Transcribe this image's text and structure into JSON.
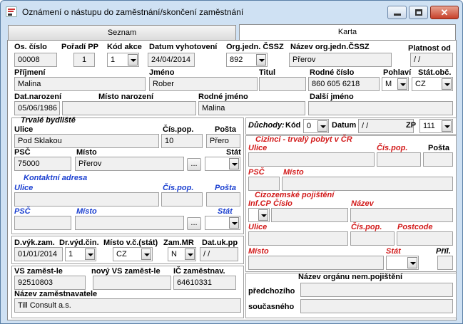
{
  "window": {
    "title": "Oznámení o nástupu do zaměstnání/skončení zaměstnání"
  },
  "tabs": {
    "list": "Seznam",
    "card": "Karta"
  },
  "row1": {
    "os_cislo_label": "Os. číslo",
    "os_cislo": "00008",
    "poradi_label": "Pořadí PP",
    "poradi": "1",
    "kod_akce_label": "Kód akce",
    "kod_akce": "1",
    "datum_vyhot_label": "Datum vyhotovení",
    "datum_vyhot": "24/04/2014",
    "org_jedn_label": "Org.jedn. ČSSZ",
    "org_jedn": "892",
    "nazev_org_label": "Název org.jedn.ČSSZ",
    "nazev_org": "Přerov",
    "platnost_label": "Platnost od",
    "platnost": "/ /"
  },
  "row2": {
    "prijmeni_label": "Příjmení",
    "prijmeni": "Malina",
    "jmeno_label": "Jméno",
    "jmeno": "Rober",
    "titul_label": "Titul",
    "titul": "",
    "rodne_cislo_label": "Rodné číslo",
    "rodne_cislo": "860 605 6218",
    "pohlavi_label": "Pohlaví",
    "pohlavi": "M",
    "stat_obc_label": "Stát.obč.",
    "stat_obc": "CZ"
  },
  "row3": {
    "dat_nar_label": "Dat.narození",
    "dat_nar": "05/06/1986",
    "misto_nar_label": "Místo narození",
    "misto_nar": "",
    "rodne_jmeno_label": "Rodné jméno",
    "rodne_jmeno": "Malina",
    "dalsi_jmeno_label": "Další jméno",
    "dalsi_jmeno": ""
  },
  "trvale": {
    "heading": "Trvalé bydliště",
    "ulice_label": "Ulice",
    "ulice": "Pod Sklakou",
    "cis_pop_label": "Čís.pop.",
    "cis_pop": "10",
    "posta_label": "Pošta",
    "posta": "Přero",
    "psc_label": "PSČ",
    "psc": "75000",
    "misto_label": "Místo",
    "misto": "Přerov",
    "stat_label": "Stát",
    "stat": "",
    "dots": "..."
  },
  "kontakt": {
    "heading": "Kontaktní adresa",
    "ulice_label": "Ulice",
    "ulice": "",
    "cis_pop_label": "Čís.pop.",
    "cis_pop": "",
    "posta_label": "Pošta",
    "posta": "",
    "psc_label": "PSČ",
    "psc": "",
    "misto_label": "Místo",
    "misto": "",
    "stat_label": "Stát",
    "stat": "",
    "dots": "..."
  },
  "duchody": {
    "label": "Důchody:",
    "kod_label": "Kód",
    "kod": "0",
    "datum_label": "Datum",
    "datum": "/ /",
    "zp_label": "ZP",
    "zp": "111"
  },
  "cizinci": {
    "heading": "Cizinci - trvalý pobyt v ČR",
    "ulice_label": "Ulice",
    "cis_pop_label": "Čís.pop.",
    "posta_label": "Pošta",
    "psc_label": "PSČ",
    "misto_label": "Místo"
  },
  "cizozemske": {
    "heading": "Cizozemské pojištění",
    "inf_label": "Inf.CP",
    "cislo_label": "Číslo",
    "nazev_label": "Název",
    "ulice_label": "Ulice",
    "cis_pop_label": "Čís.pop.",
    "postcode_label": "Postcode",
    "misto_label": "Místo",
    "stat_label": "Stát",
    "pril_label": "Příl."
  },
  "zamestnani": {
    "d_vyk_label": "D.výk.zam.",
    "d_vyk": "01/01/2014",
    "dr_vyd_label": "Dr.výd.čin.",
    "dr_vyd": "1",
    "misto_vc_label": "Místo v.č.(stát)",
    "misto_vc": "CZ",
    "zam_mr_label": "Zam.MR",
    "zam_mr": "N",
    "dat_uk_label": "Dat.uk.pp",
    "dat_uk": "/ /"
  },
  "zamestnavatel": {
    "vs_label": "VS zaměst-le",
    "vs": "92510803",
    "novy_vs_label": "nový VS zaměst-le",
    "novy_vs": "",
    "ic_label": "IČ zaměstnav.",
    "ic": "64610331",
    "nazev_label": "Název zaměstnavatele",
    "nazev": "Till Consult a.s."
  },
  "nem_poj": {
    "heading": "Název orgánu nem.pojištění",
    "predchoziho_label": "předchozího",
    "predchoziho": "",
    "soucasneho_label": "současného",
    "soucasneho": ""
  }
}
